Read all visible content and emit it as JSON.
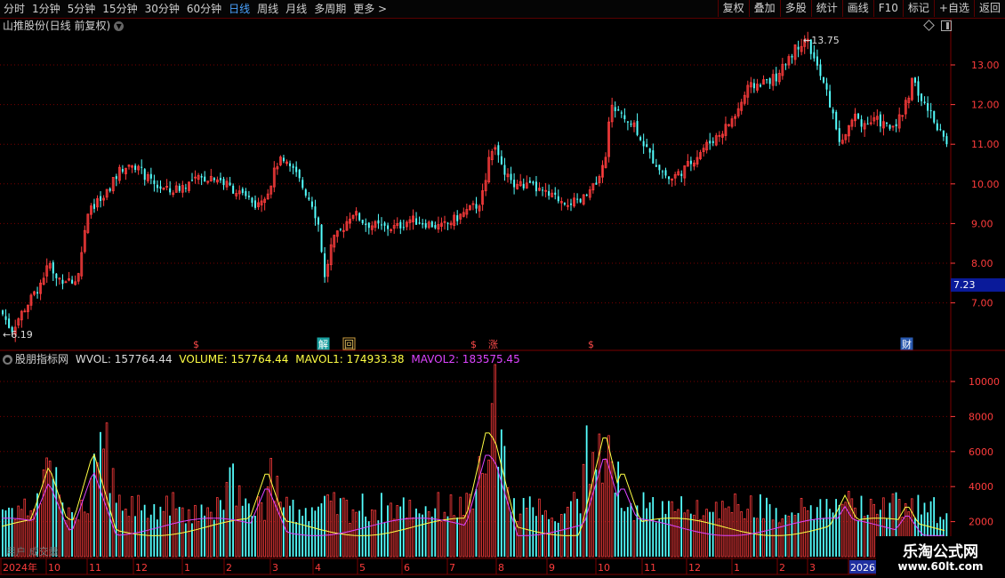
{
  "toolbar": {
    "periods": [
      "分时",
      "1分钟",
      "5分钟",
      "15分钟",
      "30分钟",
      "60分钟",
      "日线",
      "周线",
      "月线",
      "多周期",
      "更多 >"
    ],
    "active_period": "日线",
    "buttons": [
      "复权",
      "叠加",
      "多股",
      "统计",
      "画线",
      "F10",
      "标记",
      "+自选",
      "返回"
    ]
  },
  "chart": {
    "title": "山推股份(日线 前复权)",
    "high_label": "13.75",
    "low_label": "6.19",
    "current_price": "7.23",
    "price_ticks": [
      "13.00",
      "12.00",
      "11.00",
      "10.00",
      "9.00",
      "8.00",
      "7.00"
    ],
    "events": [
      {
        "label": "$",
        "type": "red"
      },
      {
        "label": "解",
        "type": "teal"
      },
      {
        "label": "回",
        "type": "orange"
      },
      {
        "label": "$",
        "type": "red"
      },
      {
        "label": "涨",
        "type": "red"
      },
      {
        "label": "$",
        "type": "red"
      },
      {
        "label": "财",
        "type": "blue"
      }
    ]
  },
  "indicator": {
    "name": "股朋指标网",
    "wol": "WVOL: 157764.44",
    "volume": "VOLUME: 157764.44",
    "mavol1": "MAVOL1: 174933.38",
    "mavol2": "MAVOL2: 183575.45",
    "ticks": [
      "10000",
      "8000",
      "6000",
      "4000",
      "2000"
    ],
    "colors": {
      "wol": "#dddddd",
      "volume": "#ffff44",
      "mavol1": "#ffff44",
      "mavol2": "#dd44ff"
    }
  },
  "xaxis": {
    "labels": [
      "2024年",
      "10",
      "11",
      "12",
      "1",
      "2",
      "3",
      "4",
      "5",
      "6",
      "7",
      "8",
      "9",
      "10",
      "11",
      "12",
      "1",
      "2",
      "3",
      "2026"
    ]
  },
  "volume_overlay_text": "用户 成交量",
  "brand": {
    "name": "乐淘公式网",
    "url": "www.60lt.com"
  },
  "colors": {
    "up": "#ff3c3c",
    "down": "#54ffff",
    "grid": "#7a0000",
    "axis": "#ff3c3c",
    "active": "#4aa3ff"
  }
}
